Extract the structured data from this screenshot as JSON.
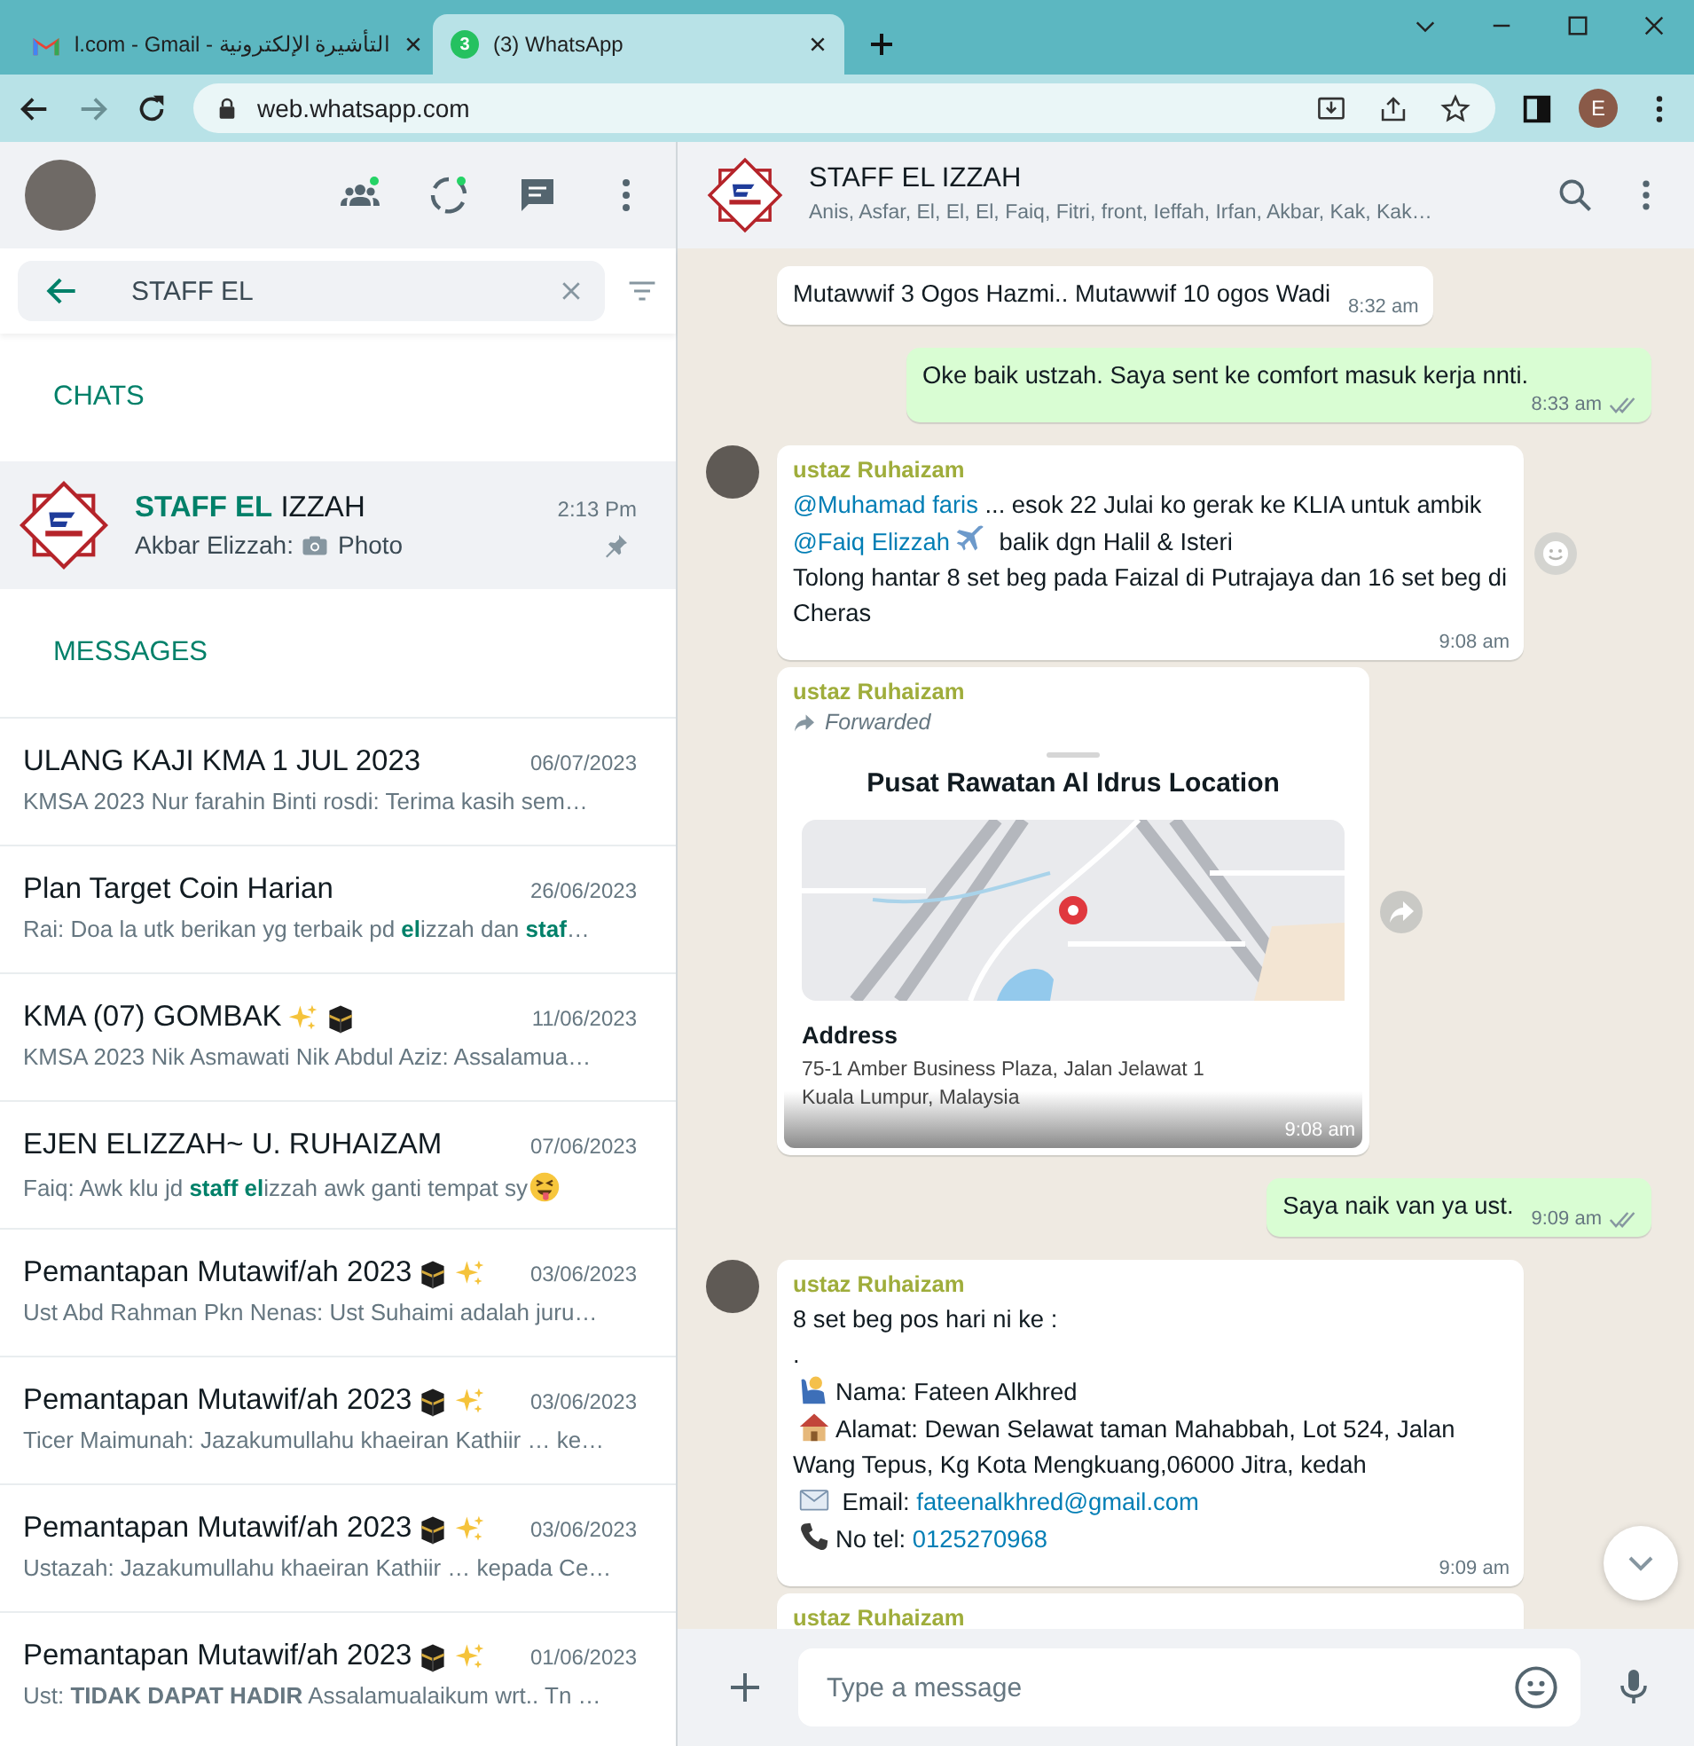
{
  "browser": {
    "tabs": [
      {
        "title": "l.com - Gmail - التأشيرة الإلكترونية",
        "kind": "gmail",
        "selected": false
      },
      {
        "title": "(3) WhatsApp",
        "kind": "whatsapp",
        "badge": "3",
        "selected": true
      }
    ],
    "url": "web.whatsapp.com",
    "profile_initial": "E"
  },
  "sidebar": {
    "search": {
      "value": "STAFF EL"
    },
    "chats_heading": "CHATS",
    "chats": [
      {
        "title": "**STAFF EL** IZZAH",
        "time": "2:13 Pm",
        "sender": "Akbar Elizzah:",
        "preview_icon": {
          "kind": "photo"
        },
        "preview": "Photo",
        "pinned": true,
        "selected": true
      }
    ],
    "messages_heading": "MESSAGES",
    "messages": [
      {
        "title": "ULANG KAJI KMA 1 JUL 2023",
        "date": "06/07/2023",
        "preview": "KMSA 2023 Nur farahin Binti rosdi: Terima kasih sem…"
      },
      {
        "title": "Plan Target Coin Harian",
        "date": "26/06/2023",
        "preview": "Rai: Doa la utk berikan yg terbaik pd **el**izzah dan **staf**…",
        "highlight": true
      },
      {
        "title": "KMA (07) GOMBAK",
        "emojis": [
          {
            "kind": "sparkles"
          },
          {
            "kind": "kaaba"
          }
        ],
        "date": "11/06/2023",
        "preview": "KMSA 2023 Nik Asmawati Nik Abdul Aziz: Assalamua…"
      },
      {
        "title": "EJEN ELIZZAH~ U. RUHAIZAM",
        "date": "07/06/2023",
        "preview": "Faiq: Awk klu jd **staff el**izzah awk ganti tempat sy",
        "preview_icon": {
          "kind": "tongue"
        },
        "highlight": true
      },
      {
        "title": "Pemantapan Mutawif/ah 2023",
        "emojis": [
          {
            "kind": "kaaba"
          },
          {
            "kind": "sparkles"
          }
        ],
        "date": "03/06/2023",
        "preview": "Ust Abd Rahman Pkn Nenas: Ust Suhaimi adalah juru…"
      },
      {
        "title": "Pemantapan Mutawif/ah 2023",
        "emojis": [
          {
            "kind": "kaaba"
          },
          {
            "kind": "sparkles"
          }
        ],
        "date": "03/06/2023",
        "preview": "Ticer Maimunah: Jazakumullahu khaeiran Kathiir … ke…"
      },
      {
        "title": "Pemantapan Mutawif/ah 2023",
        "emojis": [
          {
            "kind": "kaaba"
          },
          {
            "kind": "sparkles"
          }
        ],
        "date": "03/06/2023",
        "preview": "Ustazah: Jazakumullahu khaeiran Kathiir … kepada Ce…"
      },
      {
        "title": "Pemantapan Mutawif/ah 2023",
        "emojis": [
          {
            "kind": "kaaba"
          },
          {
            "kind": "sparkles"
          }
        ],
        "date": "01/06/2023",
        "preview": "Ust: **TIDAK DAPAT HADIR** Assalamualaikum wrt.. Tn …",
        "highlight": false
      }
    ]
  },
  "chat": {
    "title": "STAFF EL IZZAH",
    "members": "Anis, Asfar, El, El, El, Faiq, Fitri, front, Ieffah, Irfan, Akbar, Kak, Kak…",
    "messages": [
      {
        "kind": "text",
        "outgoing": false,
        "parts": [
          {
            "kind": "text",
            "text": "Mutawwif 3 Ogos Hazmi.. Mutawwif 10 ogos Wadi"
          }
        ],
        "time": "8:32 am"
      },
      {
        "kind": "text",
        "outgoing": true,
        "parts": [
          {
            "kind": "text",
            "text": "Oke baik ustzah. Saya sent ke comfort masuk kerja nnti."
          }
        ],
        "time": "8:33 am",
        "read": false
      },
      {
        "kind": "text",
        "outgoing": false,
        "sender": "ustaz Ruhaizam",
        "avatar": true,
        "parts": [
          {
            "kind": "link",
            "text": "@Muhamad faris"
          },
          {
            "kind": "text",
            "text": " ... esok 22 Julai ko gerak ke KLIA untuk ambik "
          },
          {
            "kind": "link",
            "text": "@Faiq Elizzah"
          },
          {
            "kind": "plane"
          },
          {
            "kind": "text",
            "text": " balik dgn Halil & Isteri"
          },
          {
            "kind": "break"
          },
          {
            "kind": "text",
            "text": "Tolong hantar 8 set beg pada Faizal di Putrajaya dan 16 set beg di Cheras"
          }
        ],
        "time": "9:08 am",
        "reaction_button": true
      },
      {
        "kind": "location",
        "outgoing": false,
        "sender": "ustaz Ruhaizam",
        "forwarded": "Forwarded",
        "title": "Pusat Rawatan Al Idrus Location",
        "address_label": "Address",
        "address": [
          "75-1 Amber Business Plaza, Jalan Jelawat 1",
          "Kuala Lumpur, Malaysia"
        ],
        "time": "9:08 am",
        "forward_button": true
      },
      {
        "kind": "text",
        "outgoing": true,
        "parts": [
          {
            "kind": "text",
            "text": "Saya naik van ya ust."
          }
        ],
        "time": "9:09 am",
        "read": false
      },
      {
        "kind": "text",
        "outgoing": false,
        "sender": "ustaz Ruhaizam",
        "avatar": true,
        "parts": [
          {
            "kind": "text",
            "text": "8 set beg pos hari ni ke :"
          },
          {
            "kind": "break"
          },
          {
            "kind": "text",
            "text": "."
          },
          {
            "kind": "break"
          },
          {
            "kind": "person"
          },
          {
            "kind": "text",
            "text": "Nama: Fateen Alkhred"
          },
          {
            "kind": "break"
          },
          {
            "kind": "house"
          },
          {
            "kind": "text",
            "text": "Alamat: Dewan Selawat taman Mahabbah, Lot 524, Jalan Wang Tepus, Kg Kota Mengkuang,06000 Jitra, kedah"
          },
          {
            "kind": "break"
          },
          {
            "kind": "mail"
          },
          {
            "kind": "text",
            "text": " Email: "
          },
          {
            "kind": "link",
            "text": "fateenalkhred@gmail.com"
          },
          {
            "kind": "break"
          },
          {
            "kind": "phone"
          },
          {
            "kind": "text",
            "text": "No tel: "
          },
          {
            "kind": "link",
            "text": "0125270968"
          }
        ],
        "time": "9:09 am"
      },
      {
        "kind": "partial",
        "outgoing": false,
        "sender": "ustaz Ruhaizam"
      }
    ],
    "composer": {
      "placeholder": "Type a message"
    }
  }
}
